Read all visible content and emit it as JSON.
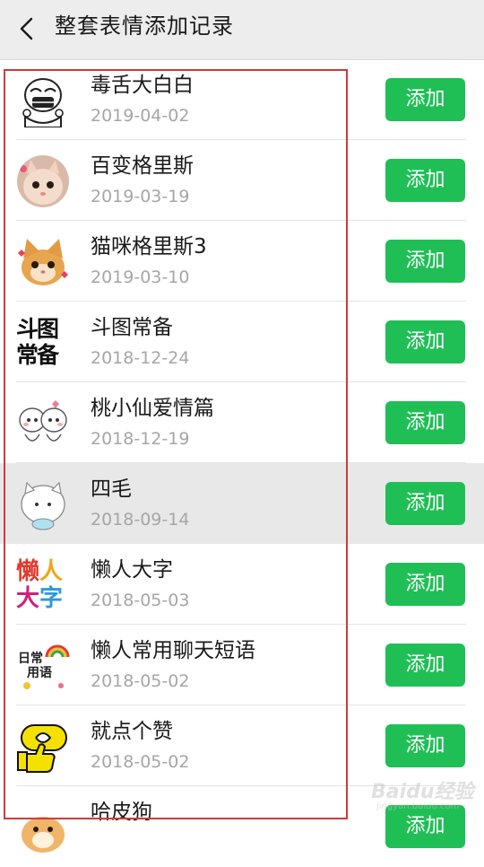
{
  "header": {
    "title": "整套表情添加记录",
    "back_icon": "chevron-left-icon"
  },
  "items": [
    {
      "name": "毒舌大白白",
      "date": "2019-04-02",
      "button": "添加"
    },
    {
      "name": "百变格里斯",
      "date": "2019-03-19",
      "button": "添加"
    },
    {
      "name": "猫咪格里斯3",
      "date": "2019-03-10",
      "button": "添加"
    },
    {
      "name": "斗图常备",
      "date": "2018-12-24",
      "button": "添加",
      "thumb_text": [
        "斗图",
        "常备"
      ]
    },
    {
      "name": "桃小仙爱情篇",
      "date": "2018-12-19",
      "button": "添加"
    },
    {
      "name": "四毛",
      "date": "2018-09-14",
      "button": "添加"
    },
    {
      "name": "懒人大字",
      "date": "2018-05-03",
      "button": "添加",
      "thumb_text": [
        "懒",
        "人",
        "大",
        "字"
      ]
    },
    {
      "name": "懒人常用聊天短语",
      "date": "2018-05-02",
      "button": "添加",
      "thumb_text": [
        "日常",
        "用语"
      ]
    },
    {
      "name": "就点个赞",
      "date": "2018-05-02",
      "button": "添加"
    },
    {
      "name": "哈皮狗",
      "date": "",
      "button": "添加"
    }
  ],
  "colors": {
    "accent_green": "#1fbf56",
    "highlight_outline": "#cf3a3a"
  },
  "watermark": {
    "text": "Baidu经验",
    "sub": "jingyan.baidu.com"
  }
}
